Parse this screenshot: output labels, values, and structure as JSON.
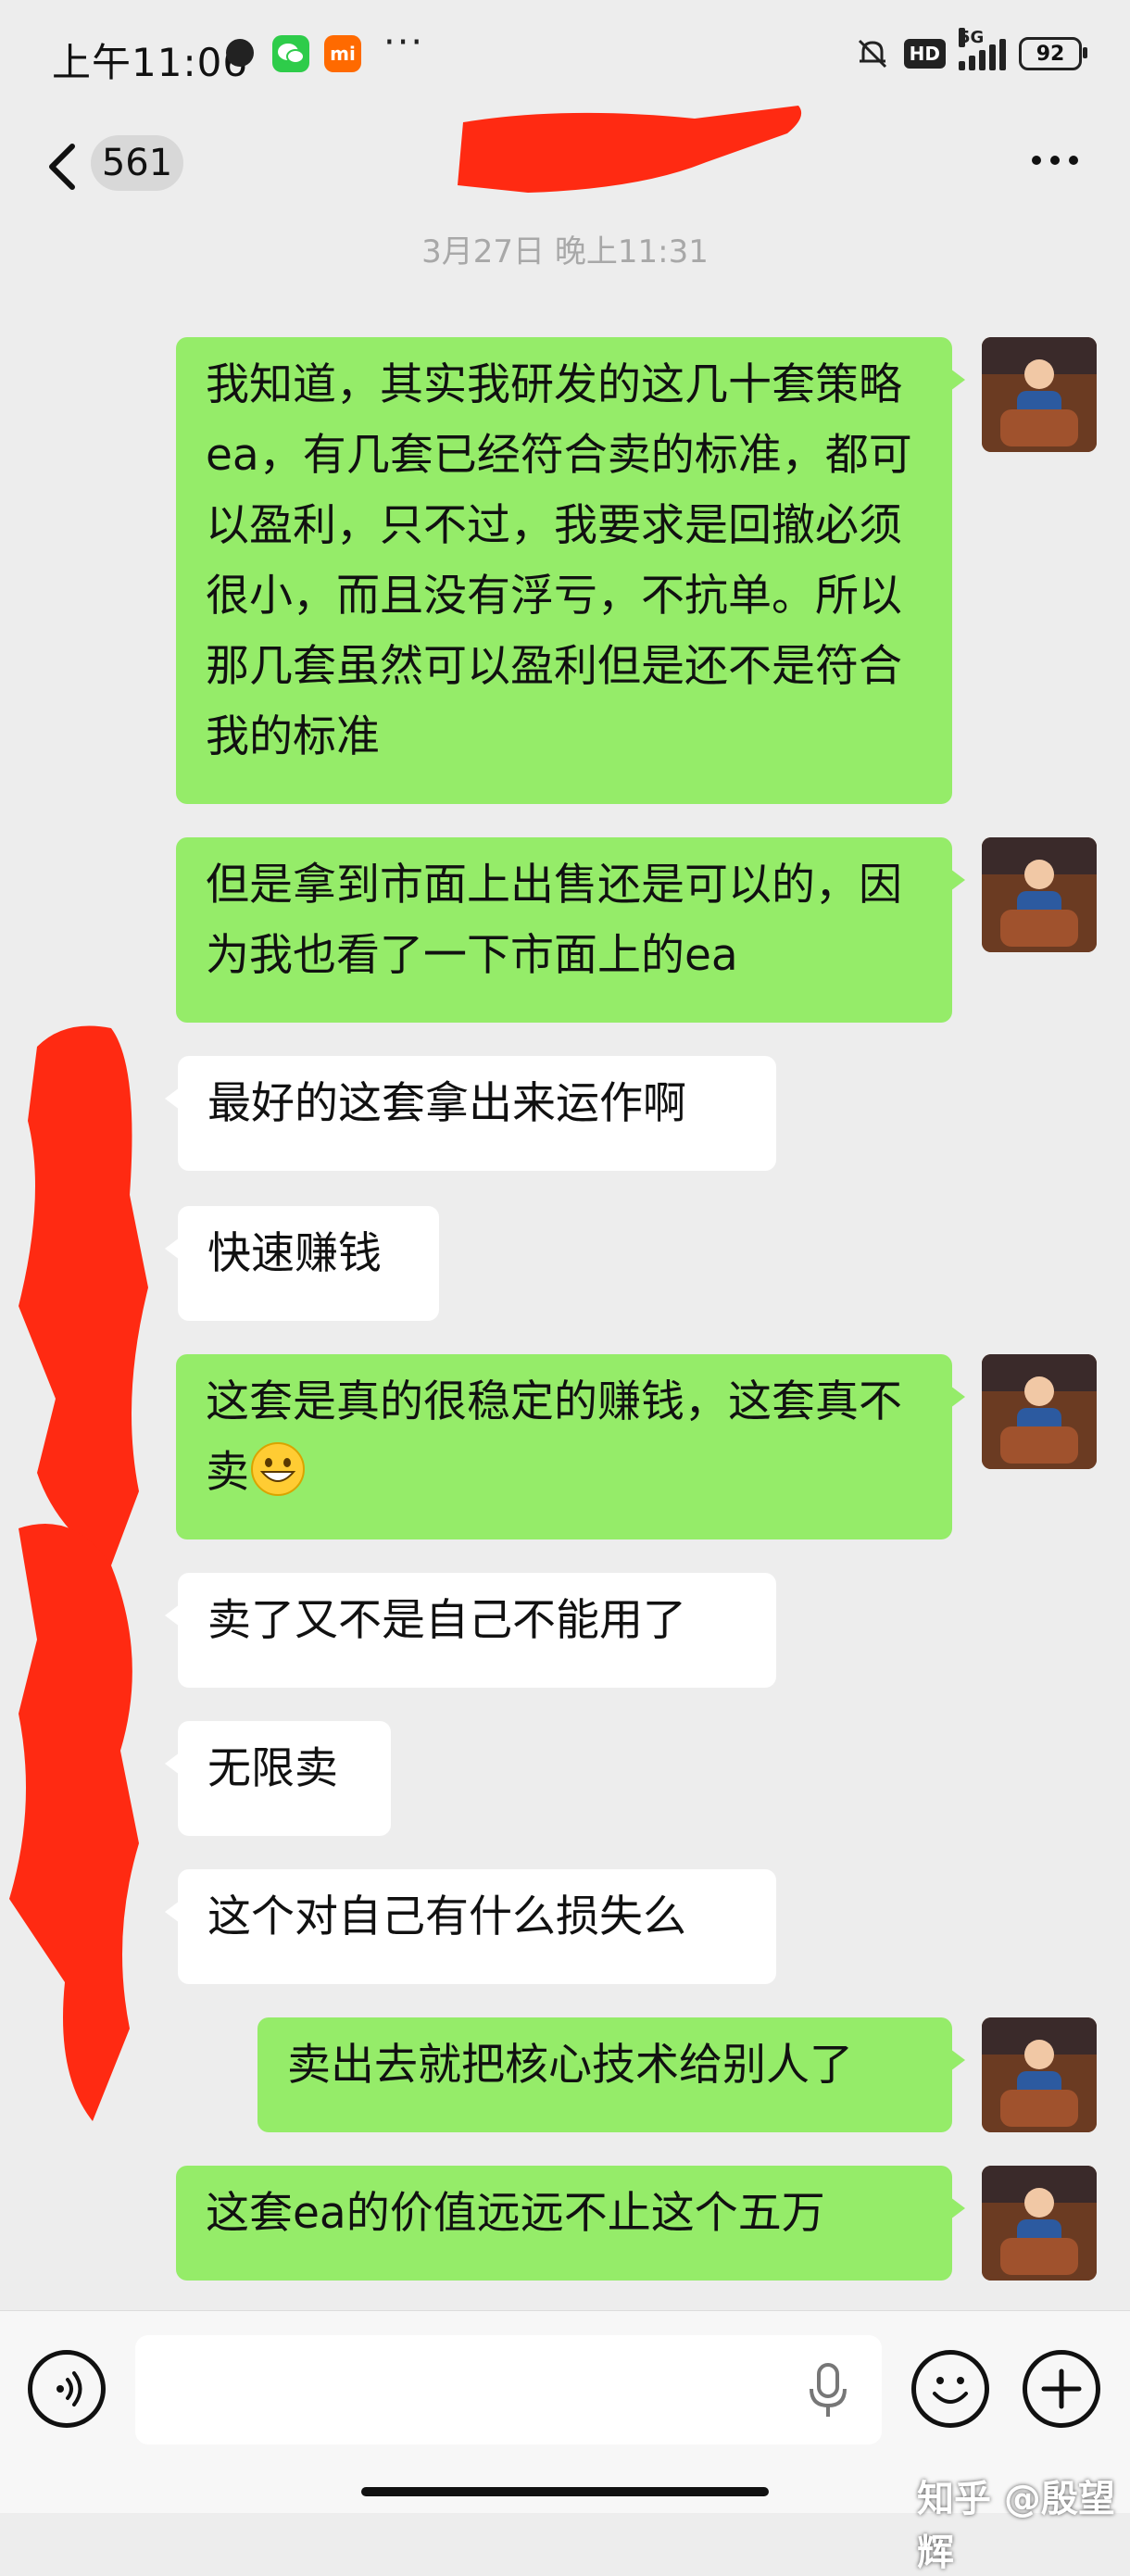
{
  "status_bar": {
    "time": "上午11:06",
    "signal": "5G",
    "hd": "HD",
    "battery": "92"
  },
  "nav": {
    "unread_count": "561",
    "contact_name_redacted": true
  },
  "timestamp": "3月27日 晚上11:31",
  "messages": [
    {
      "side": "out",
      "text": "我知道，其实我研发的这几十套策略ea，有几套已经符合卖的标准，都可以盈利，只不过，我要求是回撤必须很小，而且没有浮亏，不抗单。所以那几套虽然可以盈利但是还不是符合我的标准"
    },
    {
      "side": "out",
      "text": "但是拿到市面上出售还是可以的，因为我也看了一下市面上的ea"
    },
    {
      "side": "in",
      "text": "最好的这套拿出来运作啊"
    },
    {
      "side": "in",
      "text": "快速赚钱"
    },
    {
      "side": "out",
      "text": "这套是真的很稳定的赚钱，这套真不卖",
      "emoji": "grinning-face"
    },
    {
      "side": "in",
      "text": "卖了又不是自己不能用了"
    },
    {
      "side": "in",
      "text": "无限卖"
    },
    {
      "side": "in",
      "text": "这个对自己有什么损失么"
    },
    {
      "side": "out",
      "text": "卖出去就把核心技术给别人了"
    },
    {
      "side": "out",
      "text": "这套ea的价值远远不止这个五万"
    }
  ],
  "bottom_bar": {
    "input_value": "",
    "watermark": "知乎 @殷望辉"
  },
  "colors": {
    "background": "#ededed",
    "outgoing_bubble": "#95ec69",
    "incoming_bubble": "#ffffff",
    "redaction": "#ff2a12"
  }
}
